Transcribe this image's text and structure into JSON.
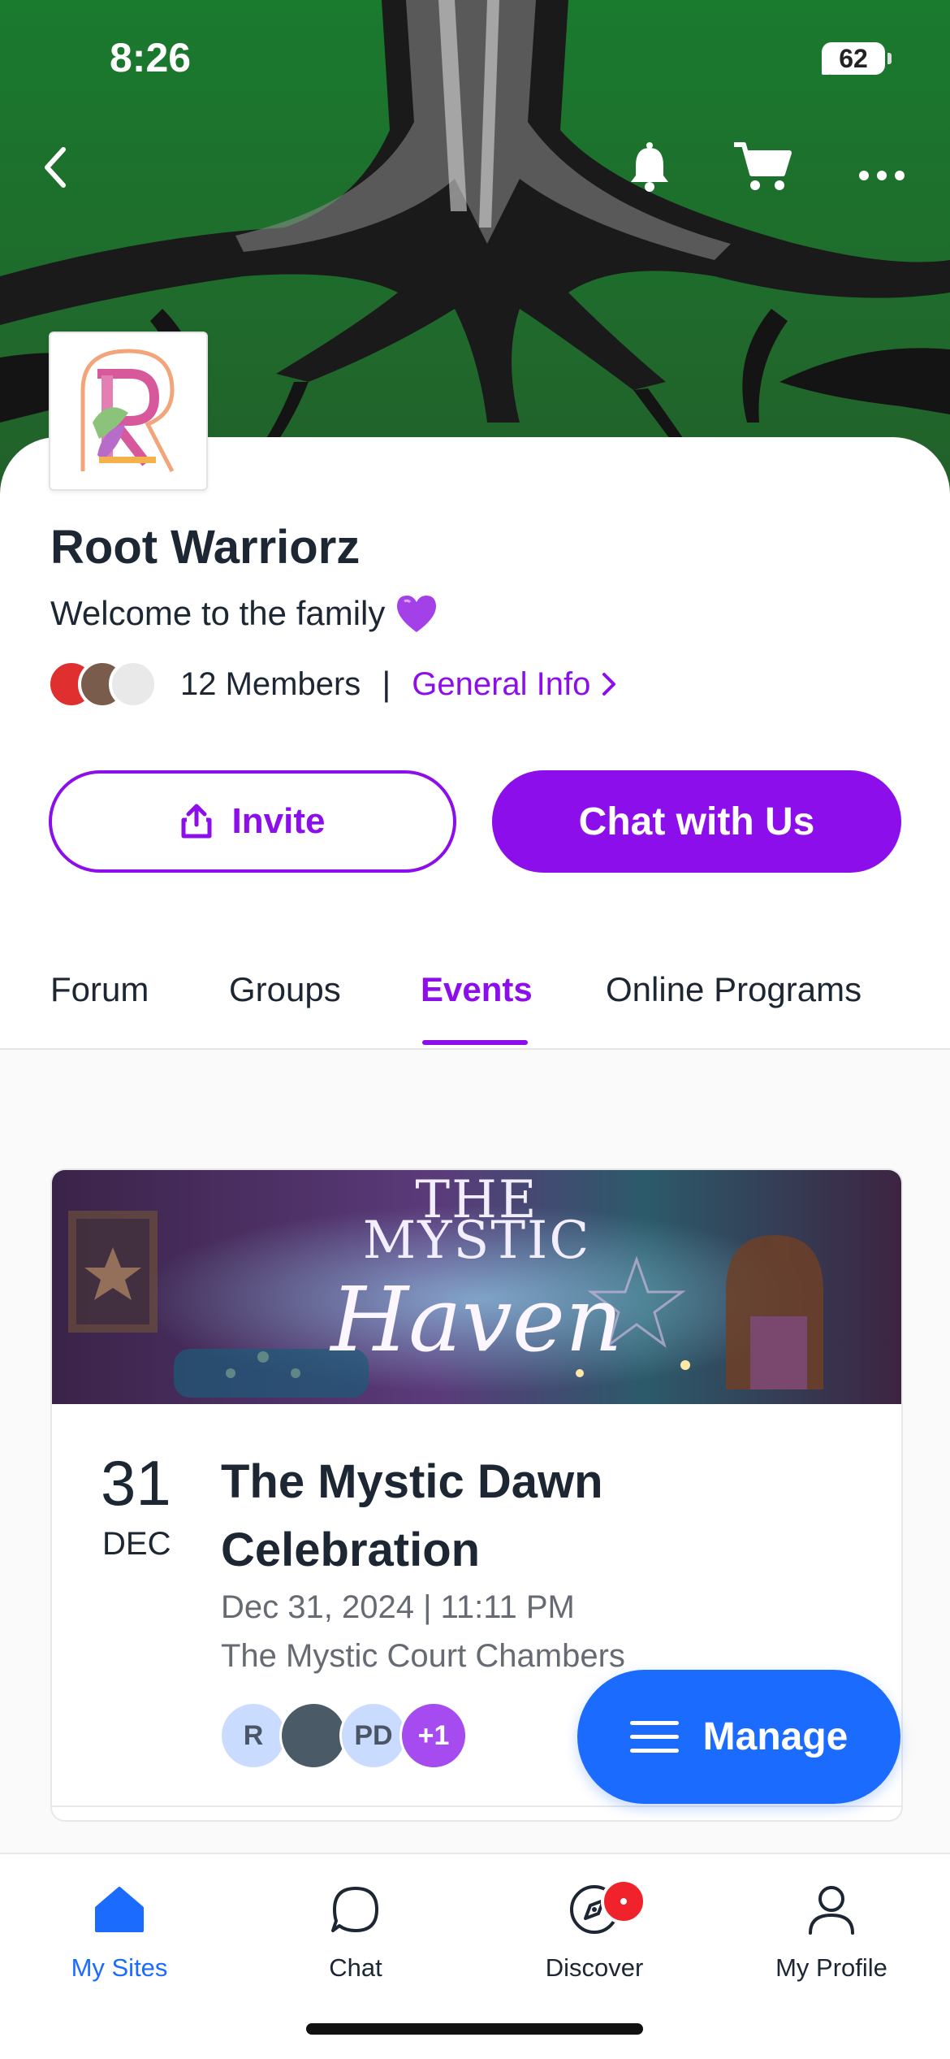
{
  "status_bar": {
    "time": "8:26",
    "battery": "62"
  },
  "site": {
    "title": "Root Warriorz",
    "subtitle": "Welcome to the family",
    "members_count": "12 Members",
    "general_info": "General Info",
    "separator": "|"
  },
  "actions": {
    "invite_label": "Invite",
    "chat_label": "Chat with Us"
  },
  "tabs": [
    {
      "label": "Forum",
      "active": false
    },
    {
      "label": "Groups",
      "active": false
    },
    {
      "label": "Events",
      "active": true
    },
    {
      "label": "Online Programs",
      "active": false
    }
  ],
  "event": {
    "banner_line_1": "THE",
    "banner_line_2": "MYSTIC",
    "banner_line_3": "Haven",
    "day": "31",
    "month": "DEC",
    "title": "The Mystic Dawn Celebration",
    "datetime": "Dec 31, 2024 | 11:11 PM",
    "location": "The Mystic Court Chambers",
    "attendees": [
      {
        "initials": "R",
        "color": "#c9dcff"
      },
      {
        "initials": "",
        "color": "#4a5a66"
      },
      {
        "initials": "PD",
        "color": "#c9dcff"
      },
      {
        "initials": "+1",
        "color": "#a54bf0"
      }
    ]
  },
  "fab": {
    "label": "Manage"
  },
  "bottom_nav": [
    {
      "label": "My Sites",
      "icon": "home-icon",
      "active": true
    },
    {
      "label": "Chat",
      "icon": "chat-icon",
      "active": false
    },
    {
      "label": "Discover",
      "icon": "compass-icon",
      "active": false,
      "badge": true
    },
    {
      "label": "My Profile",
      "icon": "person-icon",
      "active": false
    }
  ],
  "colors": {
    "accent": "#8c0eea",
    "primary_blue": "#1b6bff",
    "cover_green": "#1f6b2c",
    "badge_red": "#f0222b"
  }
}
